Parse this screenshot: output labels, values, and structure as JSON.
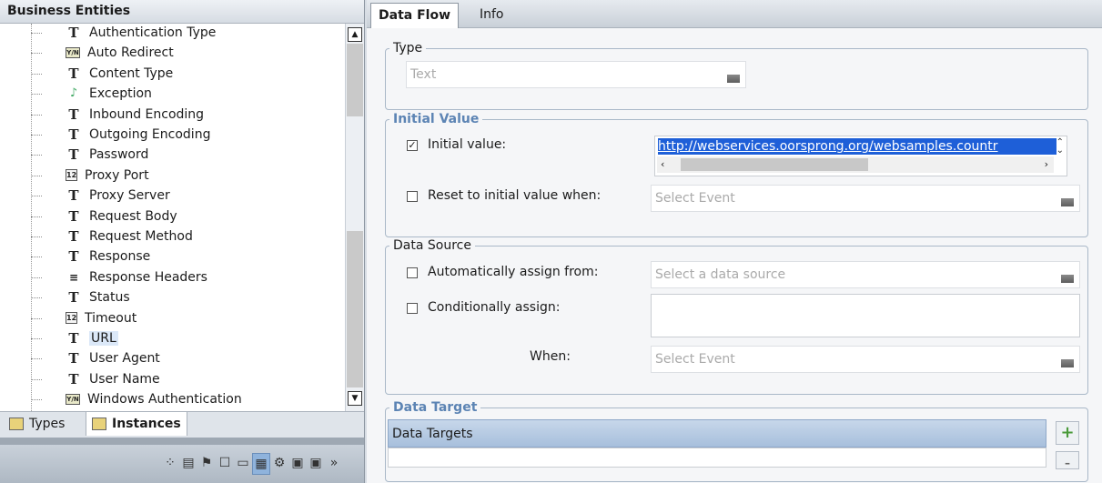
{
  "left_panel": {
    "title": "Business Entities",
    "tree_items": [
      {
        "label": "Authentication Type",
        "icon": "text-icon"
      },
      {
        "label": "Auto Redirect",
        "icon": "yesno-icon"
      },
      {
        "label": "Content Type",
        "icon": "text-icon"
      },
      {
        "label": "Exception",
        "icon": "bell-icon"
      },
      {
        "label": "Inbound Encoding",
        "icon": "text-icon"
      },
      {
        "label": "Outgoing Encoding",
        "icon": "text-icon"
      },
      {
        "label": "Password",
        "icon": "text-icon"
      },
      {
        "label": "Proxy Port",
        "icon": "number-icon"
      },
      {
        "label": "Proxy Server",
        "icon": "text-icon"
      },
      {
        "label": "Request Body",
        "icon": "text-icon"
      },
      {
        "label": "Request Method",
        "icon": "text-icon"
      },
      {
        "label": "Response",
        "icon": "text-icon"
      },
      {
        "label": "Response Headers",
        "icon": "list-icon"
      },
      {
        "label": "Status",
        "icon": "text-icon"
      },
      {
        "label": "Timeout",
        "icon": "number-icon"
      },
      {
        "label": "URL",
        "icon": "text-icon",
        "selected": true
      },
      {
        "label": "User Agent",
        "icon": "text-icon"
      },
      {
        "label": "User Name",
        "icon": "text-icon"
      },
      {
        "label": "Windows Authentication",
        "icon": "yesno-icon"
      }
    ],
    "icon_glyphs": {
      "text": "T",
      "yesno": "Y/N",
      "number": "12",
      "bell": "♪",
      "list": "≡"
    },
    "tabs": [
      "Types",
      "Instances"
    ],
    "active_tab": "Instances"
  },
  "right_panel": {
    "tabs": [
      "Data Flow",
      "Info"
    ],
    "active_tab": "Data Flow",
    "type_group": {
      "legend": "Type",
      "selected": "Text"
    },
    "initial_value_group": {
      "legend": "Initial Value",
      "initial_value_label": "Initial value:",
      "initial_value_checked": true,
      "initial_value_text": "http://webservices.oorsprong.org/websamples.countr",
      "reset_label": "Reset to initial value when:",
      "reset_checked": false,
      "reset_placeholder": "Select Event"
    },
    "data_source_group": {
      "legend": "Data Source",
      "auto_label": "Automatically assign from:",
      "auto_placeholder": "Select a data source",
      "cond_label": "Conditionally assign:",
      "when_label": "When:",
      "when_placeholder": "Select Event"
    },
    "data_target_group": {
      "legend": "Data Target",
      "header": "Data Targets"
    }
  },
  "colors": {
    "accent_blue": "#5c84b4",
    "selection": "#1e5fd8",
    "header_grad": "#c7d7ea"
  }
}
